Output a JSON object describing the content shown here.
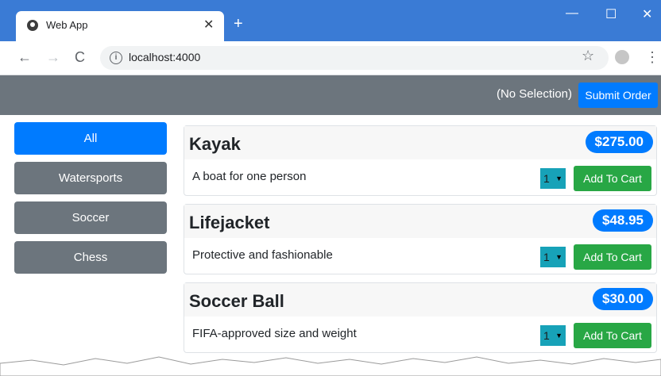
{
  "browser": {
    "tab_title": "Web App",
    "new_tab": "+",
    "close": "✕",
    "minimize": "—",
    "maximize": "☐",
    "url": "localhost:4000"
  },
  "header": {
    "selection_text": "(No Selection)",
    "submit_label": "Submit Order"
  },
  "sidebar": {
    "items": [
      {
        "label": "All",
        "active": true
      },
      {
        "label": "Watersports",
        "active": false
      },
      {
        "label": "Soccer",
        "active": false
      },
      {
        "label": "Chess",
        "active": false
      }
    ]
  },
  "products": [
    {
      "name": "Kayak",
      "price": "$275.00",
      "description": "A boat for one person",
      "quantity": "1",
      "button": "Add To Cart"
    },
    {
      "name": "Lifejacket",
      "price": "$48.95",
      "description": "Protective and fashionable",
      "quantity": "1",
      "button": "Add To Cart"
    },
    {
      "name": "Soccer Ball",
      "price": "$30.00",
      "description": "FIFA-approved size and weight",
      "quantity": "1",
      "button": "Add To Cart"
    }
  ],
  "colors": {
    "accent": "#007bff",
    "secondary": "#6c757d",
    "success": "#28a745",
    "info": "#17a2b8",
    "chrome": "#3a7bd5"
  }
}
